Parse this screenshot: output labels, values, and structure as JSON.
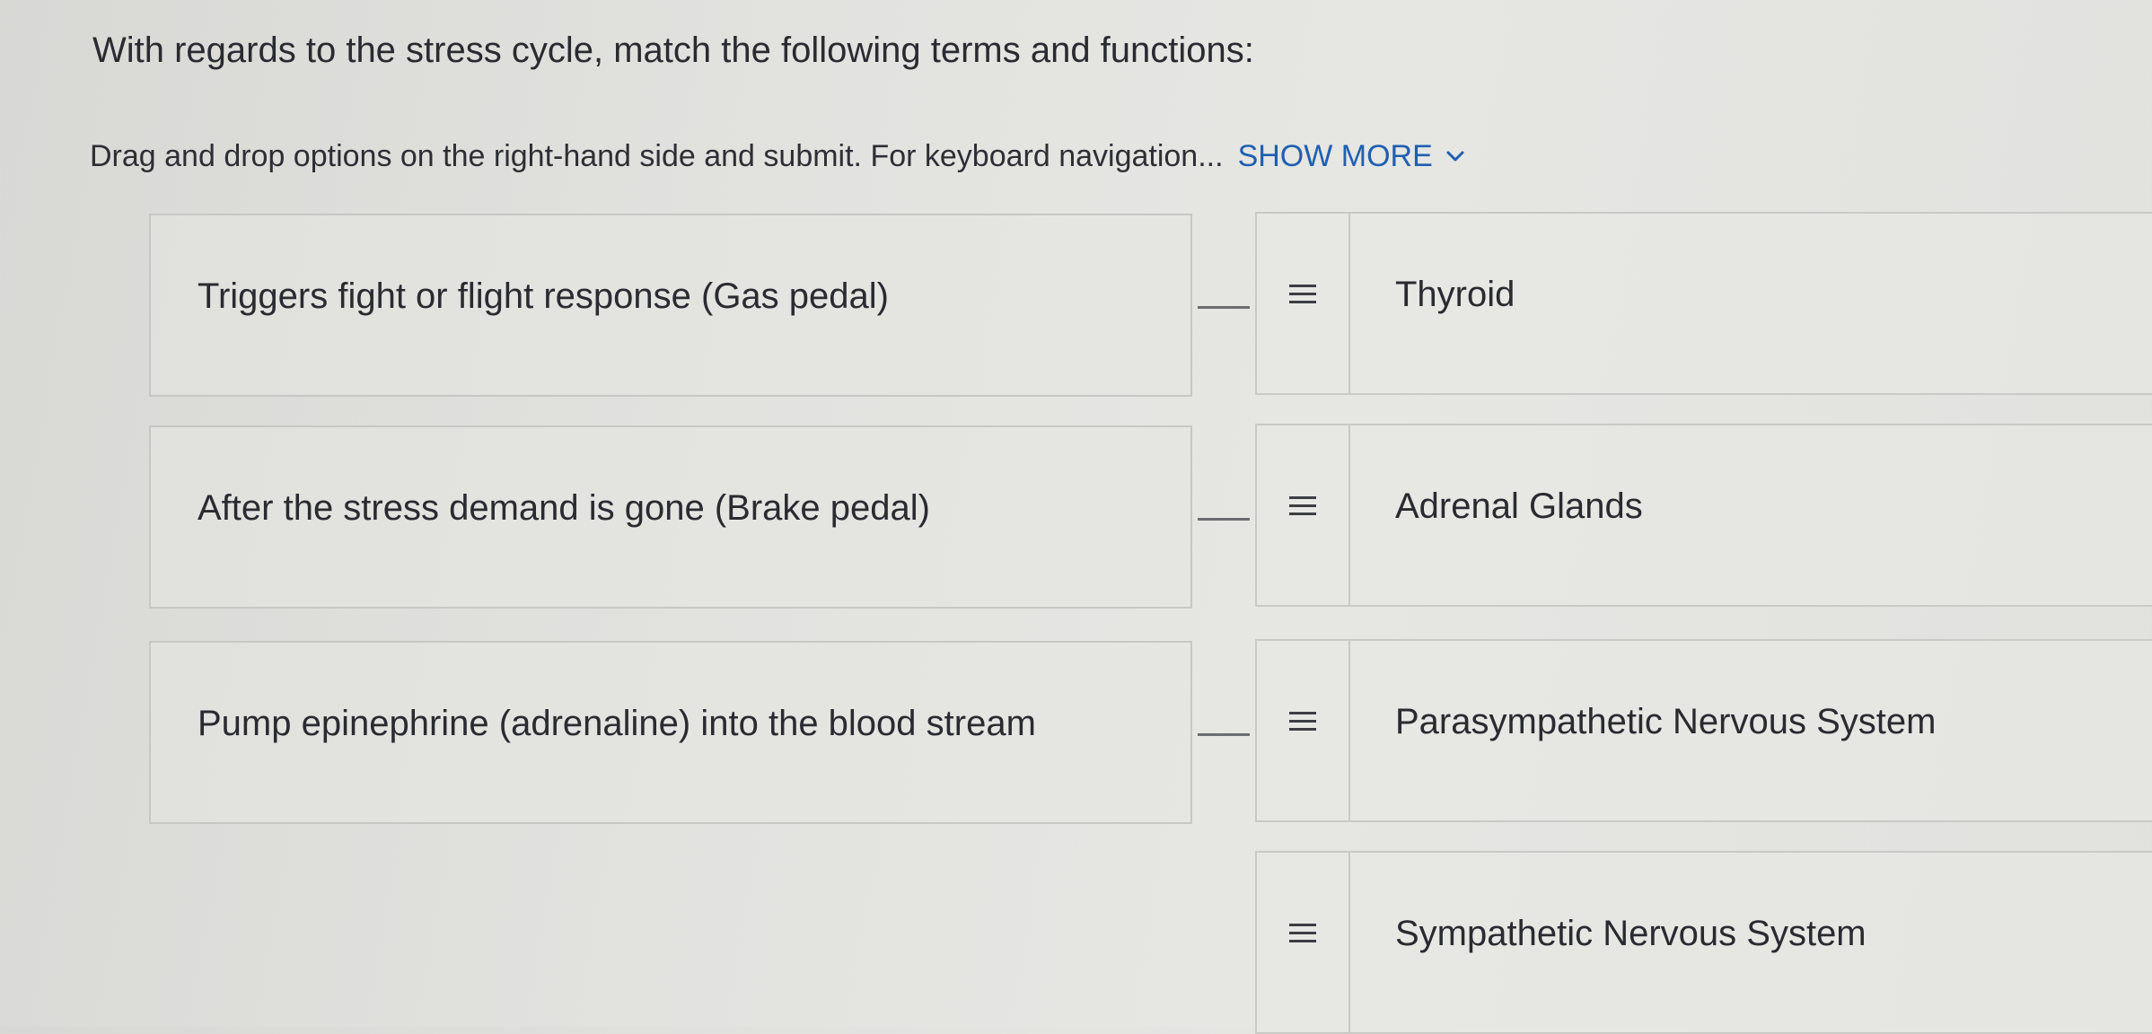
{
  "question": {
    "title": "With regards to the stress cycle, match the following terms and functions:",
    "instructions": "Drag and drop options on the right-hand side and submit. For keyboard navigation...",
    "show_more_label": "SHOW MORE"
  },
  "terms": [
    {
      "label": "Triggers fight or flight response (Gas pedal)"
    },
    {
      "label": "After the stress demand is gone (Brake pedal)"
    },
    {
      "label": "Pump epinephrine (adrenaline) into the blood stream"
    }
  ],
  "options": [
    {
      "label": "Thyroid",
      "icon": "drag-handle-icon"
    },
    {
      "label": "Adrenal Glands",
      "icon": "drag-handle-icon"
    },
    {
      "label": "Parasympathetic Nervous System",
      "icon": "drag-handle-icon"
    },
    {
      "label": "Sympathetic Nervous System",
      "icon": "drag-handle-icon"
    }
  ],
  "colors": {
    "link": "#1f5fb0",
    "text": "#2a2b31",
    "border": "#c7c7c4",
    "connector": "#6c6d70"
  }
}
